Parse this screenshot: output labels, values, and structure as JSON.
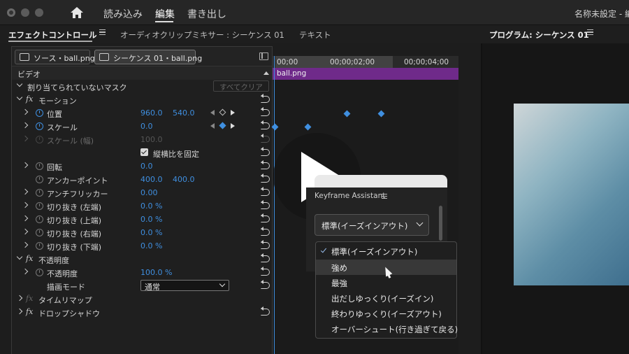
{
  "menu": {
    "items": [
      "読み込み",
      "編集",
      "書き出し"
    ],
    "active": "編集",
    "document_title": "名称未設定 - 編"
  },
  "panel_tabs": {
    "effect_controls": "エフェクトコントロール",
    "audio_mixer": "オーディオクリップミキサー : シーケンス 01",
    "text": "テキスト",
    "program": "プログラム: シーケンス 01"
  },
  "effect_controls": {
    "source_button": "ソース・ball.png",
    "sequence_button": "シーケンス 01・ball.png",
    "video_header": "ビデオ",
    "mask_row": "割り当てられていないマスク",
    "clear_all": "すべてクリア",
    "motion": "モーション",
    "position_label": "位置",
    "position_x": "960.0",
    "position_y": "540.0",
    "scale_label": "スケール",
    "scale_value": "0.0",
    "scale_width_label": "スケール (幅)",
    "scale_width_value": "100.0",
    "uniform_scale": "縦横比を固定",
    "rotation_label": "回転",
    "rotation_value": "0.0",
    "anchor_label": "アンカーポイント",
    "anchor_x": "400.0",
    "anchor_y": "400.0",
    "antiflicker_label": "アンチフリッカー",
    "antiflicker_value": "0.00",
    "crop_left_label": "切り抜き (左端)",
    "crop_left_value": "0.0 %",
    "crop_top_label": "切り抜き (上端)",
    "crop_top_value": "0.0 %",
    "crop_right_label": "切り抜き (右端)",
    "crop_right_value": "0.0 %",
    "crop_bottom_label": "切り抜き (下端)",
    "crop_bottom_value": "0.0 %",
    "opacity_group": "不透明度",
    "opacity_label": "不透明度",
    "opacity_value": "100.0 %",
    "blend_label": "描画モード",
    "blend_value": "通常",
    "time_remap": "タイムリマップ",
    "drop_shadow": "ドロップシャドウ"
  },
  "timeline": {
    "ticks": [
      "00;00",
      "00;00;02;00",
      "00;00;04;00"
    ],
    "clip_name": "ball.png"
  },
  "keyframe_assistant": {
    "title": "Keyframe Assistant",
    "selected": "標準(イーズインアウト)",
    "options": [
      "標準(イーズインアウト)",
      "強め",
      "最強",
      "出だしゆっくり(イーズイン)",
      "終わりゆっくり(イーズアウト)",
      "オーバーシュート(行き過ぎて戻る)"
    ]
  },
  "colors": {
    "accent": "#3f8fe0",
    "clip": "#6f2a8a"
  },
  "icons": [
    "home-icon",
    "panel-menu-icon",
    "stopwatch-icon",
    "reset-icon",
    "keyframe-icon",
    "play-icon",
    "cursor-icon",
    "checkmark-icon"
  ]
}
